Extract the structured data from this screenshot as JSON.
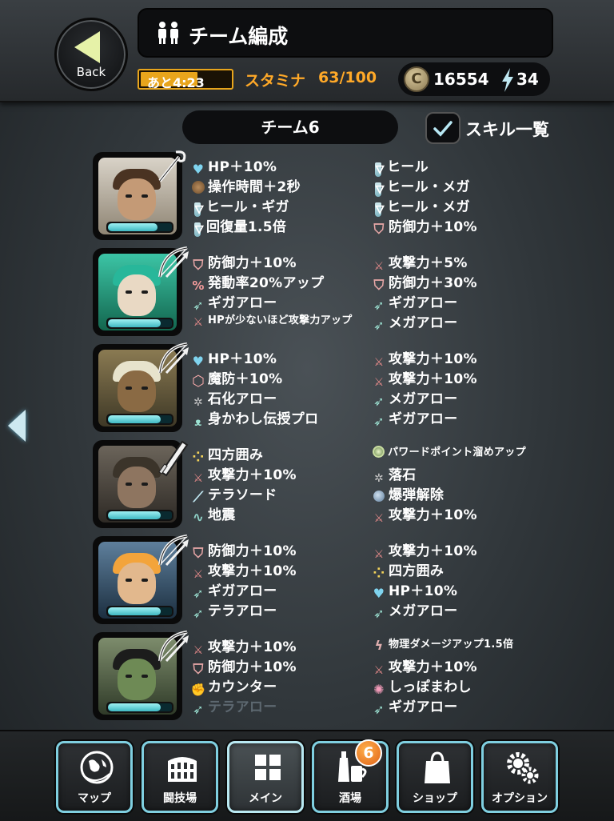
{
  "header": {
    "back_label": "Back",
    "title": "チーム編成",
    "stamina_timer": "あと4:23",
    "stamina_label": "スタミナ",
    "stamina_value": "63/100",
    "stamina_fraction": 0.63,
    "coins": "16554",
    "energy": "34"
  },
  "team": {
    "name": "チーム6",
    "skill_list_label": "スキル一覧",
    "skill_list_checked": true
  },
  "units": [
    {
      "skills_left": [
        {
          "icon": "heart-icon",
          "text": "HP＋10%"
        },
        {
          "icon": "clock-icon",
          "text": "操作時間＋2秒"
        },
        {
          "icon": "potion-icon",
          "text": "ヒール・ギガ"
        },
        {
          "icon": "potion-up-icon",
          "text": "回復量1.5倍"
        }
      ],
      "skills_right": [
        {
          "icon": "potion-icon",
          "text": "ヒール"
        },
        {
          "icon": "potion-icon",
          "text": "ヒール・メガ"
        },
        {
          "icon": "potion-icon",
          "text": "ヒール・メガ"
        },
        {
          "icon": "shield-icon",
          "text": "防御力＋10%"
        }
      ],
      "hp_fraction": 0.78,
      "weapon": "staff-icon"
    },
    {
      "skills_left": [
        {
          "icon": "shield-icon",
          "text": "防御力＋10%"
        },
        {
          "icon": "percent-icon",
          "text": "発動率20%アップ"
        },
        {
          "icon": "arrow-icon",
          "text": "ギガアロー"
        },
        {
          "icon": "sword-icon",
          "text": "HPが少ないほど攻撃力アップ",
          "small": true
        }
      ],
      "skills_right": [
        {
          "icon": "sword-icon",
          "text": "攻撃力＋5%"
        },
        {
          "icon": "shield-icon",
          "text": "防御力＋30%"
        },
        {
          "icon": "arrow-icon",
          "text": "ギガアロー"
        },
        {
          "icon": "arrow-icon",
          "text": "メガアロー"
        }
      ],
      "hp_fraction": 0.82,
      "weapon": "bow-icon"
    },
    {
      "skills_left": [
        {
          "icon": "heart-icon",
          "text": "HP＋10%"
        },
        {
          "icon": "hex-icon",
          "text": "魔防＋10%"
        },
        {
          "icon": "rock-icon",
          "text": "石化アロー"
        },
        {
          "icon": "dodge-icon",
          "text": "身かわし伝授プロ"
        }
      ],
      "skills_right": [
        {
          "icon": "sword-icon",
          "text": "攻撃力＋10%"
        },
        {
          "icon": "sword-icon",
          "text": "攻撃力＋10%"
        },
        {
          "icon": "arrow-icon",
          "text": "メガアロー"
        },
        {
          "icon": "arrow-icon",
          "text": "ギガアロー"
        }
      ],
      "hp_fraction": 0.82,
      "weapon": "bow-icon"
    },
    {
      "skills_left": [
        {
          "icon": "dots-icon",
          "text": "四方囲み"
        },
        {
          "icon": "sword-icon",
          "text": "攻撃力＋10%"
        },
        {
          "icon": "blade-icon",
          "text": "テラソード"
        },
        {
          "icon": "wave-icon",
          "text": "地震"
        }
      ],
      "skills_right": [
        {
          "icon": "orb-icon",
          "text": "パワードポイント溜めアップ",
          "small": true
        },
        {
          "icon": "rock-icon",
          "text": "落石"
        },
        {
          "icon": "bomb-icon",
          "text": "爆弾解除"
        },
        {
          "icon": "sword-icon",
          "text": "攻撃力＋10%"
        }
      ],
      "hp_fraction": 0.82,
      "weapon": "sword-icon"
    },
    {
      "skills_left": [
        {
          "icon": "shield-icon",
          "text": "防御力＋10%"
        },
        {
          "icon": "sword-icon",
          "text": "攻撃力＋10%"
        },
        {
          "icon": "arrow-icon",
          "text": "ギガアロー"
        },
        {
          "icon": "arrow-icon",
          "text": "テラアロー"
        }
      ],
      "skills_right": [
        {
          "icon": "sword-icon",
          "text": "攻撃力＋10%"
        },
        {
          "icon": "dots-icon",
          "text": "四方囲み"
        },
        {
          "icon": "heart-icon",
          "text": "HP＋10%"
        },
        {
          "icon": "arrow-icon",
          "text": "メガアロー"
        }
      ],
      "hp_fraction": 0.82,
      "weapon": "bow-icon"
    },
    {
      "skills_left": [
        {
          "icon": "sword-icon",
          "text": "攻撃力＋10%"
        },
        {
          "icon": "shield-icon",
          "text": "防御力＋10%"
        },
        {
          "icon": "fist-icon",
          "text": "カウンター"
        },
        {
          "icon": "arrow-icon",
          "text": "テラアロー",
          "dim": true
        }
      ],
      "skills_right": [
        {
          "icon": "bolt-icon",
          "text": "物理ダメージアップ1.5倍",
          "small": true
        },
        {
          "icon": "sword-icon",
          "text": "攻撃力＋10%"
        },
        {
          "icon": "spin-icon",
          "text": "しっぽまわし"
        },
        {
          "icon": "arrow-icon",
          "text": "ギガアロー"
        }
      ],
      "hp_fraction": 0.82,
      "weapon": "bow-icon"
    }
  ],
  "nav": [
    {
      "label": "マップ",
      "icon": "globe-icon"
    },
    {
      "label": "闘技場",
      "icon": "colosseum-icon"
    },
    {
      "label": "メイン",
      "icon": "grid-icon",
      "active": true
    },
    {
      "label": "酒場",
      "icon": "tavern-icon"
    },
    {
      "label": "ショップ",
      "icon": "bag-icon"
    },
    {
      "label": "オプション",
      "icon": "gears-icon"
    }
  ],
  "tavern_badge": "6",
  "colors": {
    "accent_stamina": "#ffa928",
    "frame_cyan": "#7fcfe0",
    "badge_orange": "#f07a24"
  }
}
